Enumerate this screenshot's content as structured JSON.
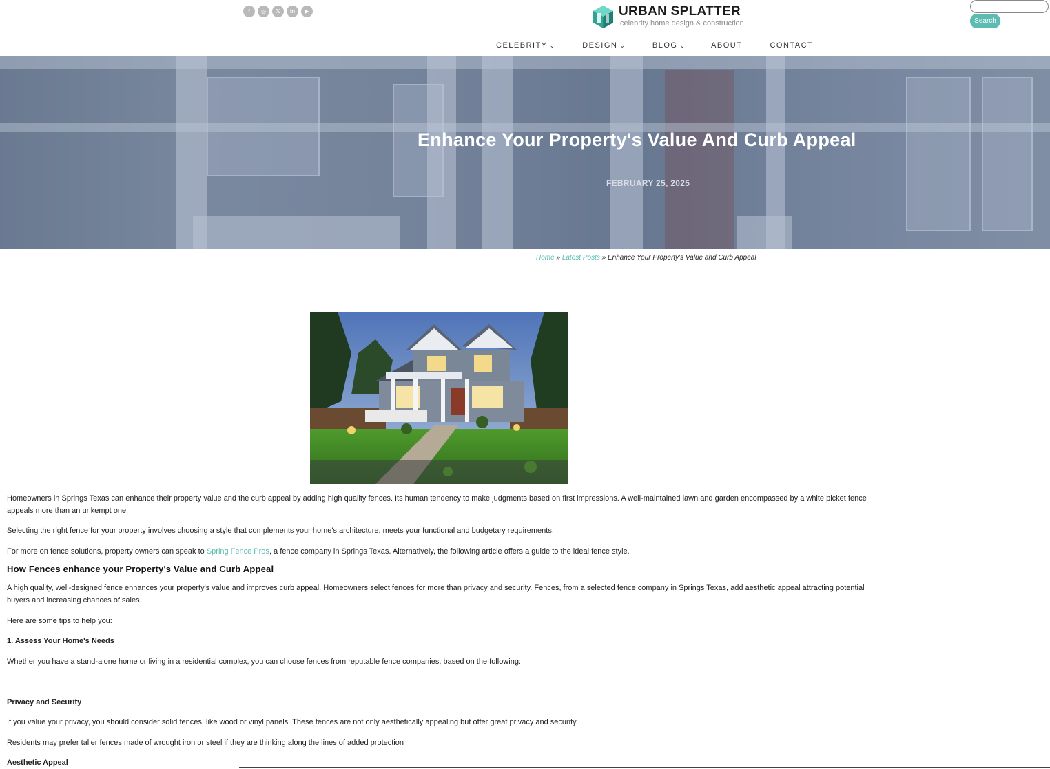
{
  "header": {
    "social": [
      {
        "icon": "facebook-icon",
        "glyph": "f"
      },
      {
        "icon": "instagram-icon",
        "glyph": "◎"
      },
      {
        "icon": "x-icon",
        "glyph": "𝕏"
      },
      {
        "icon": "linkedin-icon",
        "glyph": "in"
      },
      {
        "icon": "youtube-icon",
        "glyph": "▶"
      }
    ],
    "logo_title": "URBAN SPLATTER",
    "logo_tagline": "celebrity home design & construction",
    "search_placeholder": "",
    "search_button": "Search",
    "accent_color": "#5cbcb1"
  },
  "nav": {
    "items": [
      {
        "label": "CELEBRITY",
        "dropdown": "⌄"
      },
      {
        "label": "DESIGN",
        "dropdown": "⌄"
      },
      {
        "label": "BLOG",
        "dropdown": "⌄"
      },
      {
        "label": "ABOUT",
        "dropdown": ""
      },
      {
        "label": "CONTACT",
        "dropdown": ""
      }
    ]
  },
  "hero": {
    "title": "Enhance Your Property's Value And Curb Appeal",
    "date": "FEBRUARY 25, 2025"
  },
  "breadcrumb": {
    "home": "Home",
    "sep1": " » ",
    "section": "Latest Posts",
    "sep2": " » ",
    "current": "Enhance Your Property's Value and Curb Appeal"
  },
  "article": {
    "p1": "Homeowners in Springs Texas can enhance their property value and the curb appeal by adding high quality fences. Its human tendency to make judgments based on first impressions. A well-maintained lawn and garden encompassed by a white picket fence appeals more than an unkempt one.",
    "p2": "Selecting the right fence for your property involves choosing a style that complements your home's architecture, meets your functional and budgetary requirements.",
    "p3_before": "For more on fence solutions, property owners can speak to ",
    "p3_link": "Spring Fence Pros",
    "p3_after": ", a fence company in Springs Texas. Alternatively, the following article offers a guide to the ideal fence style.",
    "h2": "How Fences enhance your Property's Value and Curb Appeal",
    "p4": "A high quality, well-designed fence enhances your property's value and improves curb appeal. Homeowners select fences for more than privacy and security. Fences, from a selected fence company in Springs Texas, add aesthetic appeal attracting potential buyers and increasing chances of sales.",
    "p5": "Here are some tips to help you:",
    "h3": "1. Assess Your Home's Needs",
    "p6": "Whether you have a stand-alone home or living in a residential complex, you can choose fences from reputable fence companies, based on the following:",
    "h4": "Privacy and Security",
    "p7": "If you value your privacy, you should consider solid fences, like wood or vinyl panels. These fences are not only aesthetically appealing but offer great privacy and security.",
    "p8": "Residents may prefer taller fences made of wrought iron or steel if they are thinking along the lines of added protection",
    "h5": "Aesthetic Appeal"
  }
}
